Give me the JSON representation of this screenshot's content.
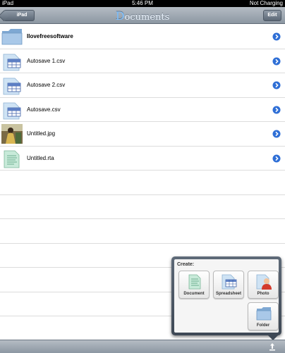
{
  "status_bar": {
    "device": "iPad",
    "time": "5:46 PM",
    "battery": "Not Charging"
  },
  "nav_bar": {
    "back_label": "iPad",
    "title_first": "D",
    "title_rest": "ocuments",
    "edit_label": "Edit"
  },
  "files": [
    {
      "name": "Ilovefreesoftware",
      "icon": "folder-icon",
      "bold": true
    },
    {
      "name": "Autosave 1.csv",
      "icon": "spreadsheet-icon"
    },
    {
      "name": "Autosave 2.csv",
      "icon": "spreadsheet-icon"
    },
    {
      "name": "Autosave.csv",
      "icon": "spreadsheet-icon"
    },
    {
      "name": "Untitled.jpg",
      "icon": "photo-thumbnail"
    },
    {
      "name": "Untitled.rta",
      "icon": "document-icon"
    }
  ],
  "create_popover": {
    "title": "Create:",
    "buttons": {
      "document": "Document",
      "spreadsheet": "Spreadsheet",
      "photo": "Photo",
      "folder": "Folder"
    }
  },
  "colors": {
    "bar_gradient_top": "#b5bcc4",
    "bar_gradient_bottom": "#8c97a2",
    "disclosure_blue": "#2f6fd6",
    "folder_blue": "#8fb6dc"
  }
}
